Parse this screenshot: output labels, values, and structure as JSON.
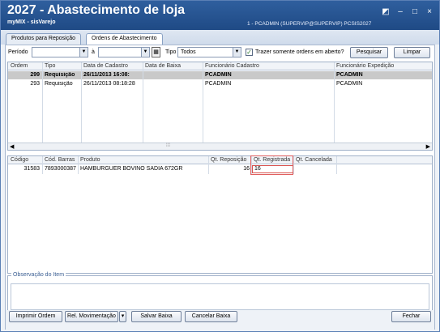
{
  "window": {
    "title": "2027 - Abastecimento de loja",
    "subtitle": "myMIX - sisVarejo",
    "user_info": "1 - PCADMIN (SUPERVIP@SUPERVIP)   PCSIS2027",
    "controls": [
      "◩",
      "–",
      "□",
      "×"
    ]
  },
  "tabs": [
    {
      "label": "Produtos para Reposição",
      "active": false
    },
    {
      "label": "Ordens de Abastecimento",
      "active": true
    }
  ],
  "filters": {
    "periodo_label": "Período",
    "periodo_from": "",
    "a_label": "à",
    "periodo_to": "",
    "tipo_label": "Tipo",
    "tipo_value": "Todos",
    "open_only_label": "Trazer somente ordens em aberto?",
    "open_only_checked": true,
    "search_button": "Pesquisar",
    "clear_button": "Limpar"
  },
  "orders": {
    "columns": [
      "Ordem",
      "Tipo",
      "Data de Cadastro",
      "Data de Baixa",
      "Funcionário Cadastro",
      "Funcionário Expedição"
    ],
    "rows": [
      {
        "ordem": "299",
        "tipo": "Requisição",
        "cadastro": "26/11/2013 16:08:",
        "baixa": "",
        "func_cad": "PCADMIN",
        "func_exp": "PCADMIN",
        "selected": true
      },
      {
        "ordem": "293",
        "tipo": "Requisição",
        "cadastro": "26/11/2013 08:18:28",
        "baixa": "",
        "func_cad": "PCADMIN",
        "func_exp": "PCADMIN",
        "selected": false
      }
    ]
  },
  "items": {
    "columns": [
      "Código",
      "Cód. Barras",
      "Produto",
      "Qt. Reposição",
      "Qt. Registrada",
      "Qt. Cancelada"
    ],
    "rows": [
      {
        "codigo": "31583",
        "barras": "7893000387",
        "produto": "HAMBURGUER BOVINO SADIA 672GR",
        "qt_repos": "16",
        "qt_reg": "16",
        "qt_canc": ""
      }
    ]
  },
  "observacao": {
    "label": "Observação do Item",
    "value": ""
  },
  "footer": {
    "print_button": "Imprimir Ordem",
    "report_button": "Rel. Movimentação",
    "save_button": "Salvar Baixa",
    "cancel_button": "Cancelar Baixa",
    "close_button": "Fechar"
  }
}
